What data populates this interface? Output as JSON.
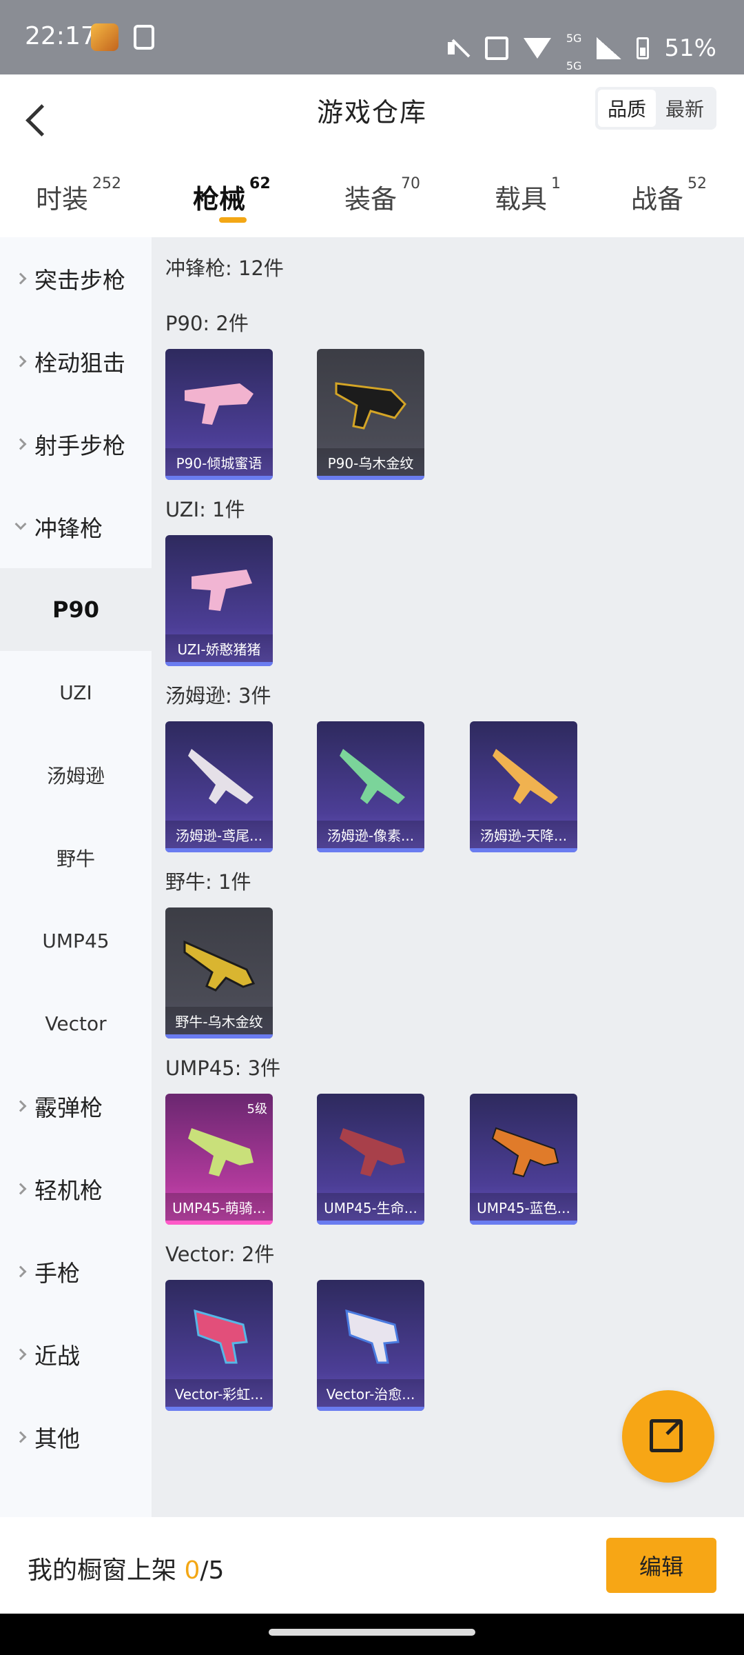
{
  "status_bar": {
    "time": "22:17",
    "net_top": "5G",
    "net_bottom": "5G",
    "battery": "51%"
  },
  "header": {
    "title": "游戏仓库",
    "sort": [
      "品质",
      "最新"
    ]
  },
  "tabs": [
    {
      "label": "时装",
      "count": "252"
    },
    {
      "label": "枪械",
      "count": "62"
    },
    {
      "label": "装备",
      "count": "70"
    },
    {
      "label": "载具",
      "count": "1"
    },
    {
      "label": "战备",
      "count": "52"
    }
  ],
  "sidebar": {
    "categories_top": [
      "突击步枪",
      "栓动狙击",
      "射手步枪"
    ],
    "expanded": "冲锋枪",
    "subs": [
      "P90",
      "UZI",
      "汤姆逊",
      "野牛",
      "UMP45",
      "Vector"
    ],
    "categories_bottom": [
      "霰弹枪",
      "轻机枪",
      "手枪",
      "近战",
      "其他"
    ]
  },
  "content": {
    "summary": "冲锋枪: 12件",
    "sections": [
      {
        "title": "P90: 2件",
        "items": [
          {
            "name": "P90-倾城蜜语",
            "style": "purple"
          },
          {
            "name": "P90-乌木金纹",
            "style": "gray"
          }
        ]
      },
      {
        "title": "UZI: 1件",
        "items": [
          {
            "name": "UZI-娇憨猪猪",
            "style": "purple"
          }
        ]
      },
      {
        "title": "汤姆逊: 3件",
        "items": [
          {
            "name": "汤姆逊-鸢尾...",
            "style": "purple"
          },
          {
            "name": "汤姆逊-像素...",
            "style": "purple"
          },
          {
            "name": "汤姆逊-天降...",
            "style": "purple"
          }
        ]
      },
      {
        "title": "野牛: 1件",
        "items": [
          {
            "name": "野牛-乌木金纹",
            "style": "gray"
          }
        ]
      },
      {
        "title": "UMP45: 3件",
        "items": [
          {
            "name": "UMP45-萌骑...",
            "style": "pink",
            "level": "5级"
          },
          {
            "name": "UMP45-生命...",
            "style": "purple"
          },
          {
            "name": "UMP45-蓝色...",
            "style": "purple"
          }
        ]
      },
      {
        "title": "Vector: 2件",
        "items": [
          {
            "name": "Vector-彩虹...",
            "style": "purple"
          },
          {
            "name": "Vector-治愈...",
            "style": "purple"
          }
        ]
      }
    ]
  },
  "bottom": {
    "showcase_label": "我的橱窗上架",
    "showcase_count": "0",
    "showcase_total": "/5",
    "edit_label": "编辑"
  },
  "colors": {
    "accent": "#f7a615",
    "purple_card": "#4c3e96",
    "gray_card": "#4a4b55",
    "pink_card": "#b13a9c"
  }
}
